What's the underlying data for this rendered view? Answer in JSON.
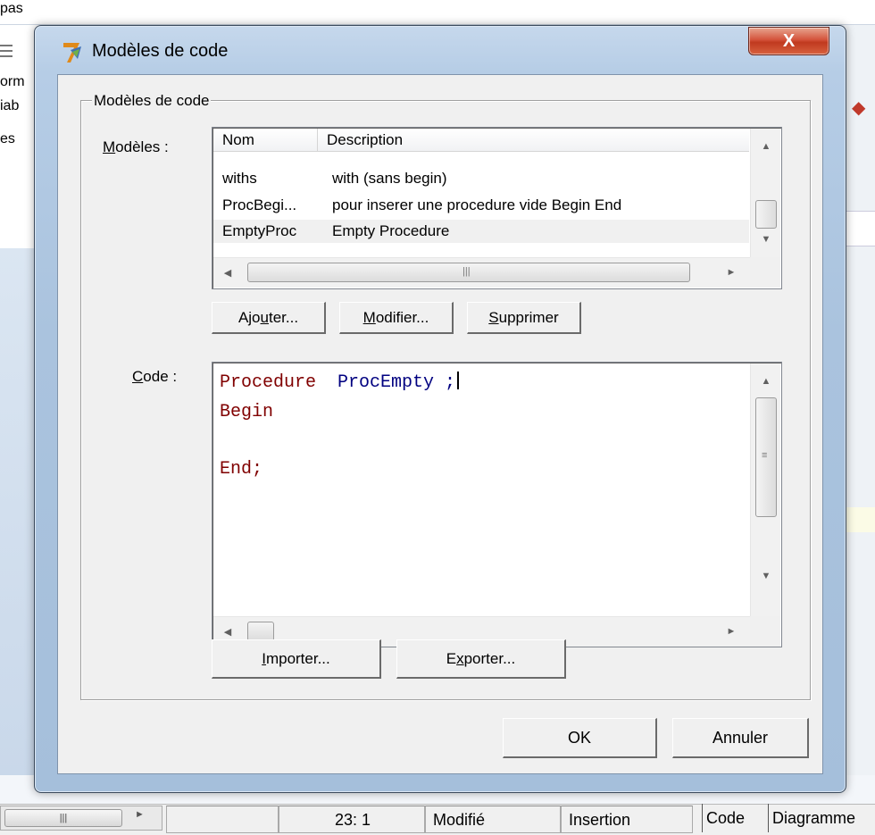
{
  "background": {
    "top_text": "pas",
    "left_items": [
      "orm",
      "iab",
      "es"
    ]
  },
  "dialog": {
    "title": "Modèles de code",
    "close_label": "X",
    "group_label": "Modèles de code",
    "models_label": "Modèles :",
    "models_label_access": "M",
    "models_label_rest": "odèles :",
    "list": {
      "columns": [
        "Nom",
        "Description"
      ],
      "rows": [
        {
          "name": "withs",
          "description": "with  (sans begin)"
        },
        {
          "name": "ProcBegi...",
          "description": "pour inserer une procedure vide Begin End"
        },
        {
          "name": "EmptyProc",
          "description": "Empty Procedure",
          "selected": true
        }
      ]
    },
    "buttons": {
      "add_pre": "Ajo",
      "add_key": "u",
      "add_post": "ter...",
      "modify_pre": "",
      "modify_key": "M",
      "modify_post": "odifier...",
      "delete_pre": "",
      "delete_key": "S",
      "delete_post": "upprimer",
      "import_pre": "",
      "import_key": "I",
      "import_post": "mporter...",
      "export_pre": "E",
      "export_key": "x",
      "export_post": "porter...",
      "ok": "OK",
      "cancel": "Annuler"
    },
    "code_label_key": "C",
    "code_label_rest": "ode :",
    "code": {
      "line1_kw": "Procedure",
      "line1_ident": "  ProcEmpty ;",
      "line2": "Begin",
      "line3": "",
      "line4": "End;"
    }
  },
  "statusbar": {
    "position": "23:  1",
    "modified": "Modifié",
    "mode": "Insertion",
    "tab_code": "Code",
    "tab_diagram": "Diagramme"
  }
}
